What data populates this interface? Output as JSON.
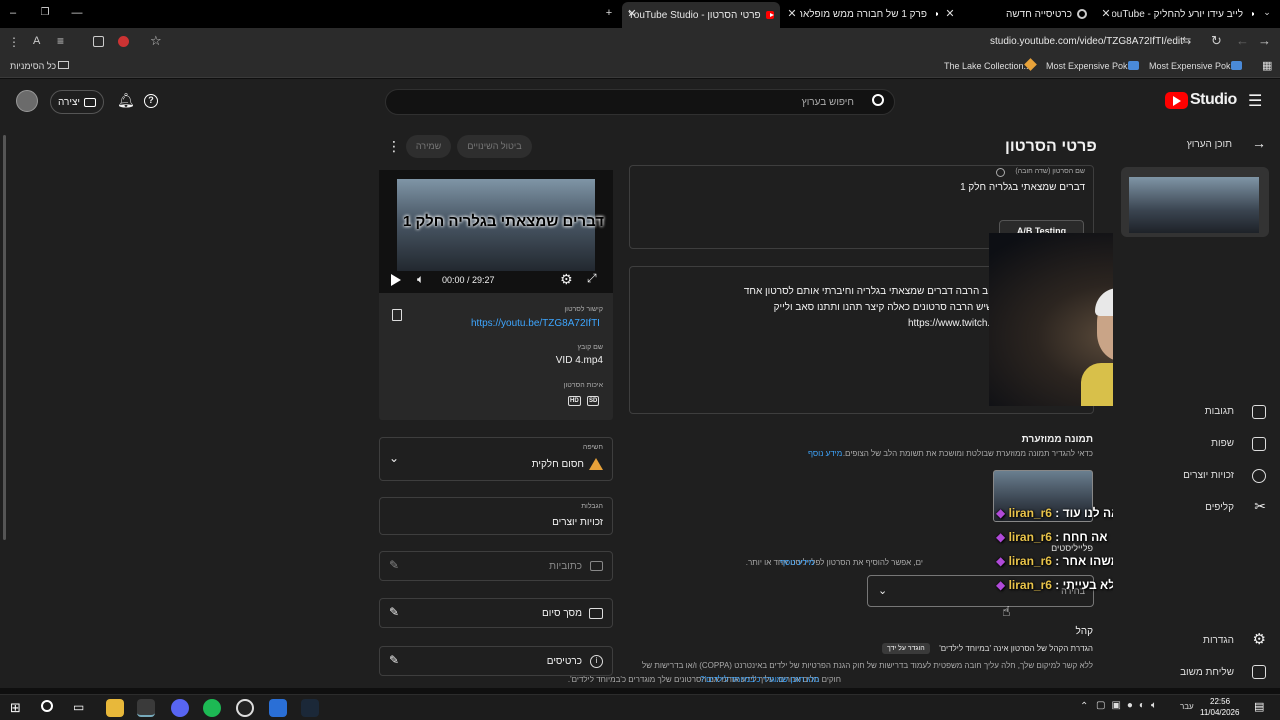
{
  "browser": {
    "tabs": [
      {
        "title": "לייב עידו יורע להחליק - YouTube"
      },
      {
        "title": "כרטיסייה חדשה"
      },
      {
        "title": "פרק 1 של חבורה ממש מופלאה"
      },
      {
        "title": "פרטי הסרטון - YouTube Studio"
      }
    ],
    "url": "studio.youtube.com/video/TZG8A72IfTI/edit",
    "bookmarks": [
      "The Lake Collection...",
      "Most Expensive Pok...",
      "Most Expensive Pok..."
    ],
    "all_bookmarks_label": "כל הסימניות"
  },
  "studio": {
    "logo_text": "Studio",
    "search_placeholder": "חיפוש בערוץ",
    "create_label": "יצירה"
  },
  "sidebar": {
    "back_label": "תוכן הערוץ",
    "items": [
      {
        "label": "תגובות",
        "icon": "comment-icon"
      },
      {
        "label": "שפות",
        "icon": "subtitles-icon"
      },
      {
        "label": "זכויות יוצרים",
        "icon": "copyright-icon"
      },
      {
        "label": "קליפים",
        "icon": "scissors-icon"
      },
      {
        "label": "הגדרות",
        "icon": "gear-icon"
      },
      {
        "label": "שליחת משוב",
        "icon": "feedback-icon"
      }
    ]
  },
  "page": {
    "title": "פרטי הסרטון",
    "undo_label": "ביטול השינויים",
    "save_label": "שמירה",
    "title_field_label": "שם הסרטון (שדה חובה)",
    "title_field_value": "דברים שמצאתי בגלריה חלק 1",
    "ab_testing_label": "A/B Testing",
    "description_lines": [
      "שוב הרבה דברים שמצאתי בגלריה וחיברתי אותם לסרטון אחד",
      "' שיש הרבה סרטונים כאלה קיצר תהנו ותתנו סאב ולייק",
      "https://www.twitch.tv"
    ],
    "thumbnail_heading": "תמונה ממוזערת",
    "thumbnail_help": "כדאי להגדיר תמונה ממוזערת שבולטת ומושכת את תשומת הלב של הצופים.",
    "learn_more": "מידע נוסף",
    "playlists_label": "פלייליסטים",
    "playlists_help": "ים, אפשר להוסיף את הסרטון לפלייליסט אחד או יותר.",
    "playlists_select": "בחירה",
    "audience_heading": "קהל",
    "audience_line": "הגדרת הקהל של הסרטון אינה 'במיוחד לילדים'",
    "audience_badge": "הוגדר על ידך",
    "coppa_line1": "ללא קשר למיקום שלך, חלה עליך חובה משפטית לעמוד בדרישות של חוק הגנת הפרטיות של ילדים באינטרנט (COPPA) ו/או בדרישות של",
    "coppa_line2": "חוקים חלים אחרים. עליך לידע אותנו אם הסרטונים שלך מוגדרים כ'במיוחד לילדים'.",
    "coppa_link": "מהו תוכן שמוגדר כ'במיוחד לילדים'?"
  },
  "video_panel": {
    "thumb_caption": "דברים שמצאתי בגלריה חלק 1",
    "time": "00:00 / 29:27",
    "link_label": "קישור לסרטון",
    "link_value": "https://youtu.be/TZG8A72IfTI",
    "file_label": "שם קובץ",
    "file_value": "VID 4.mp4",
    "quality_label": "איכות הסרטון",
    "quality_badges": [
      "SD",
      "HD"
    ],
    "visibility_label": "חשיפה",
    "visibility_value": "חסום חלקית",
    "restrictions_label": "הגבלות",
    "restrictions_value": "זכויות יוצרים",
    "captions_label": "כתוביות",
    "endscreen_label": "מסך סיום",
    "cards_label": "כרטיסים"
  },
  "chat": [
    {
      "user": "liran_r6",
      "msg": ": תראה לנו עוד"
    },
    {
      "user": "liran_r6",
      "msg": ": אה חחח"
    },
    {
      "user": "liran_r6",
      "msg": ": אז תראה משהו אחר"
    },
    {
      "user": "liran_r6",
      "msg": ": משהו לא בעייתי"
    }
  ],
  "taskbar": {
    "lang": "עבר",
    "time": "22:56",
    "date": "11/04/2026"
  }
}
